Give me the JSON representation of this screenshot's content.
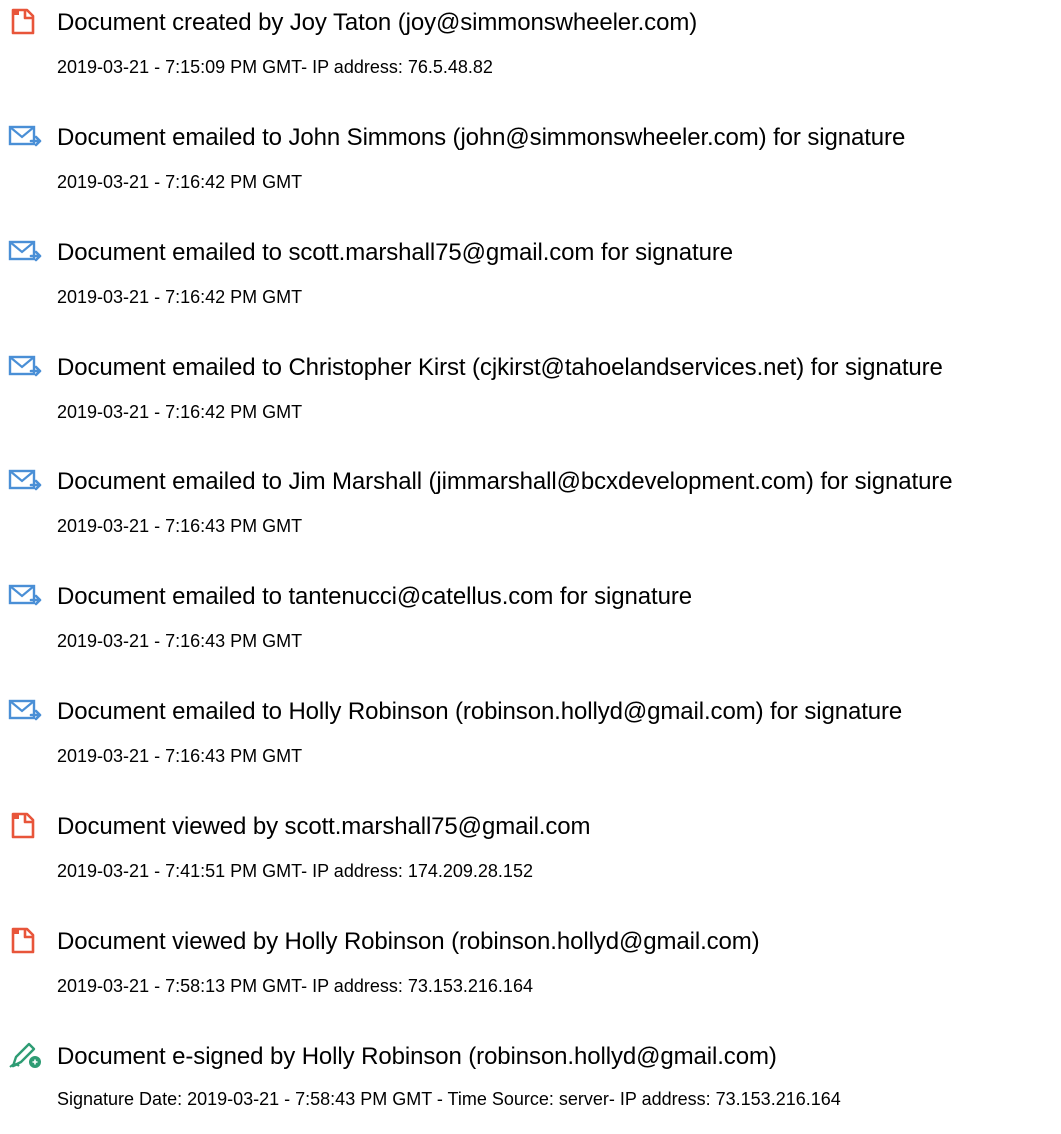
{
  "events": [
    {
      "icon": "document-created-icon",
      "title": "Document created by Joy Taton (joy@simmonswheeler.com)",
      "meta": "2019-03-21 - 7:15:09 PM GMT- IP address: 76.5.48.82"
    },
    {
      "icon": "email-sent-icon",
      "title": "Document emailed to John Simmons (john@simmonswheeler.com) for signature",
      "meta": "2019-03-21 - 7:16:42 PM GMT"
    },
    {
      "icon": "email-sent-icon",
      "title": "Document emailed to scott.marshall75@gmail.com for signature",
      "meta": "2019-03-21 - 7:16:42 PM GMT"
    },
    {
      "icon": "email-sent-icon",
      "title": "Document emailed to Christopher Kirst (cjkirst@tahoelandservices.net) for signature",
      "meta": "2019-03-21 - 7:16:42 PM GMT"
    },
    {
      "icon": "email-sent-icon",
      "title": "Document emailed to Jim Marshall (jimmarshall@bcxdevelopment.com) for signature",
      "meta": "2019-03-21 - 7:16:43 PM GMT"
    },
    {
      "icon": "email-sent-icon",
      "title": "Document emailed to tantenucci@catellus.com for signature",
      "meta": "2019-03-21 - 7:16:43 PM GMT"
    },
    {
      "icon": "email-sent-icon",
      "title": "Document emailed to Holly Robinson (robinson.hollyd@gmail.com) for signature",
      "meta": "2019-03-21 - 7:16:43 PM GMT"
    },
    {
      "icon": "document-viewed-icon",
      "title": "Document viewed by scott.marshall75@gmail.com",
      "meta": "2019-03-21 - 7:41:51 PM GMT- IP address: 174.209.28.152"
    },
    {
      "icon": "document-viewed-icon",
      "title": "Document viewed by Holly Robinson (robinson.hollyd@gmail.com)",
      "meta": "2019-03-21 - 7:58:13 PM GMT- IP address: 73.153.216.164"
    },
    {
      "icon": "e-sign-pen-icon",
      "title": "Document e-signed by Holly Robinson (robinson.hollyd@gmail.com)",
      "meta": "Signature Date: 2019-03-21 - 7:58:43 PM GMT - Time Source: server- IP address: 73.153.216.164"
    }
  ],
  "colors": {
    "document_icon": "#e8553a",
    "email_icon": "#4a8fd6",
    "sign_icon": "#2e9c74"
  }
}
